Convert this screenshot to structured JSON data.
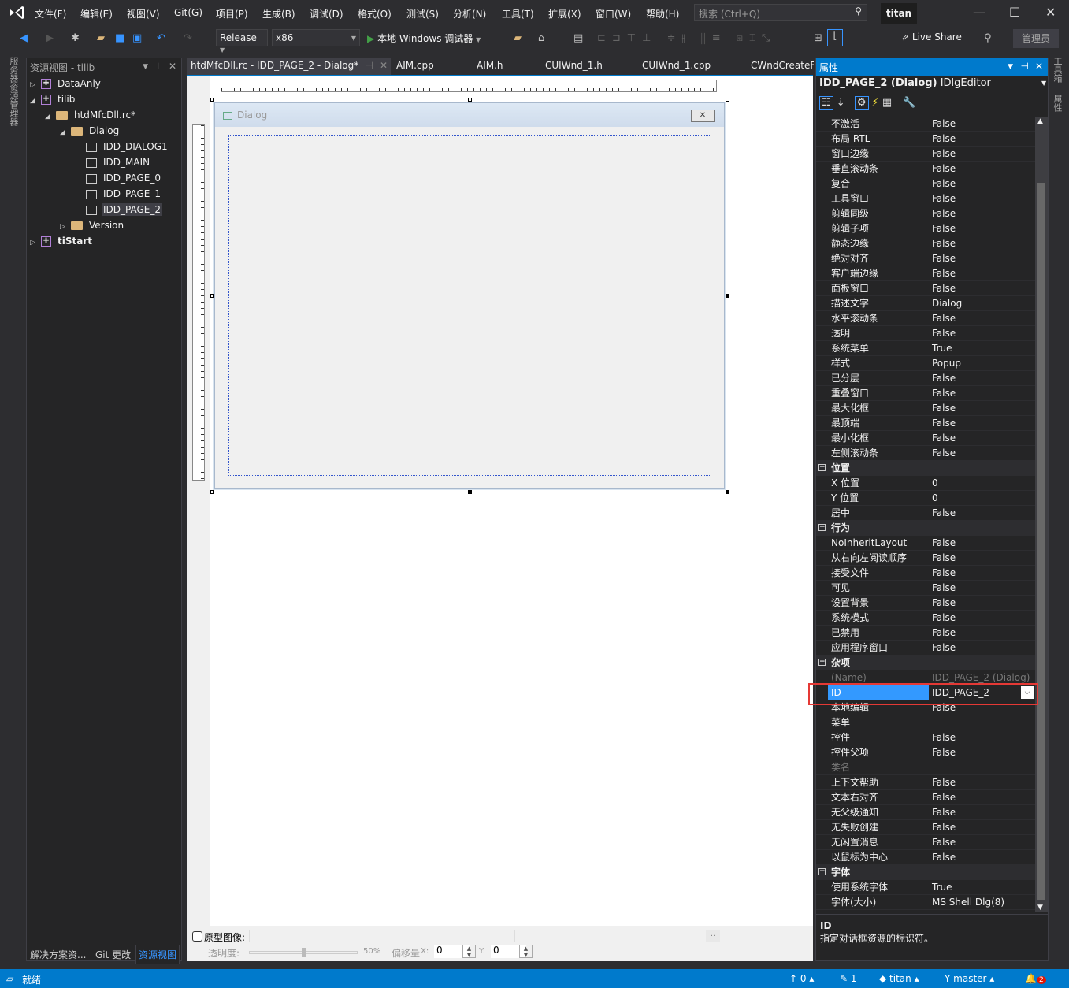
{
  "menu": [
    "文件(F)",
    "编辑(E)",
    "视图(V)",
    "Git(G)",
    "项目(P)",
    "生成(B)",
    "调试(D)",
    "格式(O)",
    "测试(S)",
    "分析(N)",
    "工具(T)",
    "扩展(X)",
    "窗口(W)",
    "帮助(H)"
  ],
  "search": {
    "placeholder": "搜索 (Ctrl+Q)"
  },
  "user": "titan",
  "toolbar": {
    "config": "Release",
    "platform": "x86",
    "run": "本地 Windows 调试器",
    "live_share": "Live Share",
    "admin": "管理员"
  },
  "left_vtab": "服务器资源管理器",
  "right_vtabs": [
    "工具箱",
    "属性"
  ],
  "resource_view": {
    "title": "资源视图 - tilib",
    "tree": [
      {
        "label": "DataAnly",
        "level": 0,
        "type": "project",
        "state": "collapsed"
      },
      {
        "label": "tilib",
        "level": 0,
        "type": "project",
        "state": "expanded"
      },
      {
        "label": "htdMfcDll.rc*",
        "level": 1,
        "type": "folder",
        "state": "expanded"
      },
      {
        "label": "Dialog",
        "level": 2,
        "type": "folder",
        "state": "expanded"
      },
      {
        "label": "IDD_DIALOG1",
        "level": 3,
        "type": "dialog"
      },
      {
        "label": "IDD_MAIN",
        "level": 3,
        "type": "dialog"
      },
      {
        "label": "IDD_PAGE_0",
        "level": 3,
        "type": "dialog"
      },
      {
        "label": "IDD_PAGE_1",
        "level": 3,
        "type": "dialog"
      },
      {
        "label": "IDD_PAGE_2",
        "level": 3,
        "type": "dialog",
        "selected": true
      },
      {
        "label": "Version",
        "level": 2,
        "type": "folder",
        "state": "collapsed"
      },
      {
        "label": "tiStart",
        "level": 0,
        "type": "project",
        "state": "collapsed",
        "bold": true
      }
    ],
    "bottom_tabs": [
      "解决方案资...",
      "Git 更改",
      "资源视图"
    ],
    "active_bottom_tab": 2
  },
  "doc_tabs": [
    "htdMfcDll.rc - IDD_PAGE_2 - Dialog*",
    "AIM.cpp",
    "AIM.h",
    "CUIWnd_1.h",
    "CUIWnd_1.cpp",
    "CWndCreateF"
  ],
  "dialog": {
    "title": "Dialog",
    "close": "✕"
  },
  "prototype": {
    "checkbox_label": "原型图像:",
    "browse": "..",
    "opacity_label": "透明度:",
    "opacity": 50,
    "opacity_text": "50%",
    "offset_label": "偏移量",
    "x_label": "X:",
    "x_value": "0",
    "y_label": "Y:",
    "y_value": "0"
  },
  "properties": {
    "title": "属性",
    "object": "IDD_PAGE_2 (Dialog)",
    "object_type": "IDlgEditor",
    "rows": [
      [
        "不激活",
        "False"
      ],
      [
        "布局 RTL",
        "False"
      ],
      [
        "窗口边缘",
        "False"
      ],
      [
        "垂直滚动条",
        "False"
      ],
      [
        "复合",
        "False"
      ],
      [
        "工具窗口",
        "False"
      ],
      [
        "剪辑同级",
        "False"
      ],
      [
        "剪辑子项",
        "False"
      ],
      [
        "静态边缘",
        "False"
      ],
      [
        "绝对对齐",
        "False"
      ],
      [
        "客户端边缘",
        "False"
      ],
      [
        "面板窗口",
        "False"
      ],
      [
        "描述文字",
        "Dialog"
      ],
      [
        "水平滚动条",
        "False"
      ],
      [
        "透明",
        "False"
      ],
      [
        "系统菜单",
        "True"
      ],
      [
        "样式",
        "Popup"
      ],
      [
        "已分层",
        "False"
      ],
      [
        "重叠窗口",
        "False"
      ],
      [
        "最大化框",
        "False"
      ],
      [
        "最顶端",
        "False"
      ],
      [
        "最小化框",
        "False"
      ],
      [
        "左侧滚动条",
        "False"
      ],
      [
        "位置",
        "",
        "cat"
      ],
      [
        "X 位置",
        "0"
      ],
      [
        "Y 位置",
        "0"
      ],
      [
        "居中",
        "False"
      ],
      [
        "行为",
        "",
        "cat"
      ],
      [
        "NoInheritLayout",
        "False"
      ],
      [
        "从右向左阅读顺序",
        "False"
      ],
      [
        "接受文件",
        "False"
      ],
      [
        "可见",
        "False"
      ],
      [
        "设置背景",
        "False"
      ],
      [
        "系统模式",
        "False"
      ],
      [
        "已禁用",
        "False"
      ],
      [
        "应用程序窗口",
        "False"
      ],
      [
        "杂项",
        "",
        "cat"
      ],
      [
        "(Name)",
        "IDD_PAGE_2 (Dialog)",
        "gray"
      ],
      [
        "ID",
        "IDD_PAGE_2",
        "sel"
      ],
      [
        "本地编辑",
        "False"
      ],
      [
        "菜单",
        ""
      ],
      [
        "控件",
        "False"
      ],
      [
        "控件父项",
        "False"
      ],
      [
        "类名",
        "",
        "gray"
      ],
      [
        "上下文帮助",
        "False"
      ],
      [
        "文本右对齐",
        "False"
      ],
      [
        "无父级通知",
        "False"
      ],
      [
        "无失败创建",
        "False"
      ],
      [
        "无闲置消息",
        "False"
      ],
      [
        "以鼠标为中心",
        "False"
      ],
      [
        "字体",
        "",
        "cat"
      ],
      [
        "使用系统字体",
        "True"
      ],
      [
        "字体(大小)",
        "MS Shell Dlg(8)"
      ]
    ],
    "desc_title": "ID",
    "desc_text": "指定对话框资源的标识符。"
  },
  "status": {
    "ready": "就绪",
    "up": "0",
    "edits": "1",
    "repo": "titan",
    "branch": "master",
    "notifications": "2"
  },
  "colors": {
    "accent": "#007acc",
    "highlight_box": "#e53935",
    "selection": "#3399ff"
  }
}
